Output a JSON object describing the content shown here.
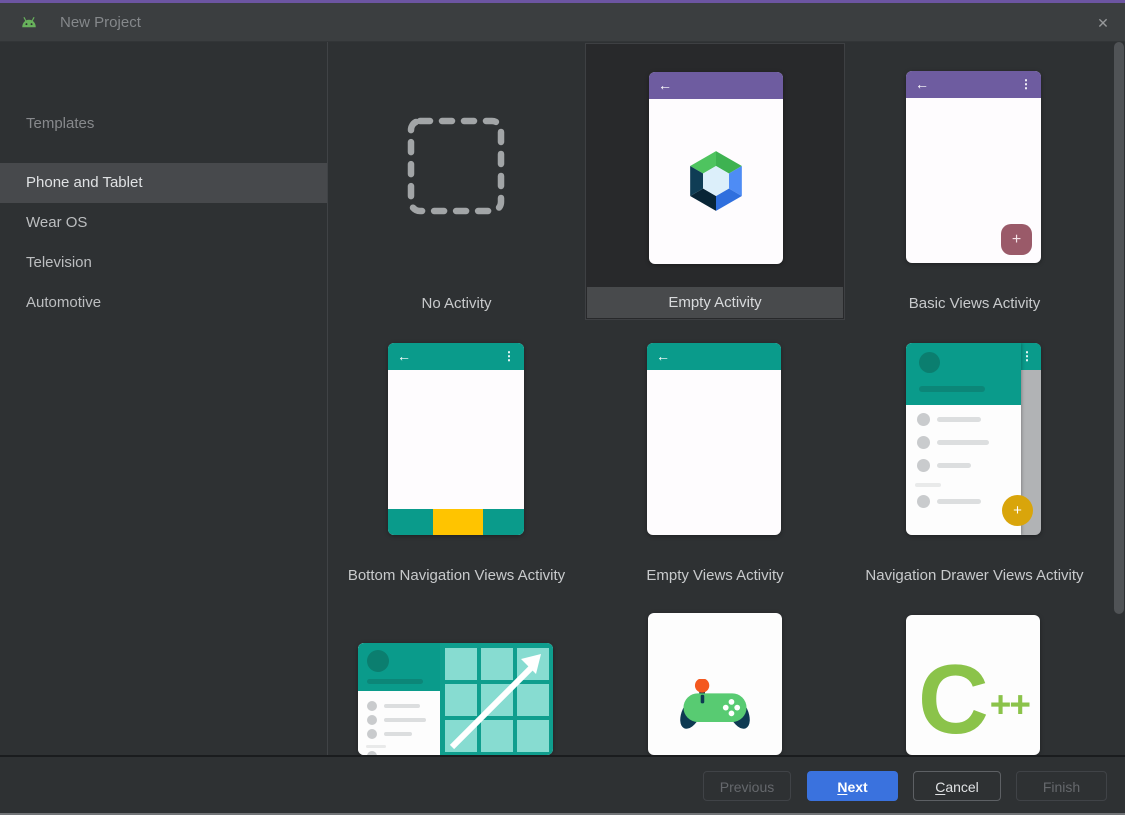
{
  "window": {
    "title": "New Project",
    "close_icon": "✕"
  },
  "sidebar": {
    "header": "Templates",
    "items": [
      {
        "label": "Phone and Tablet",
        "selected": true
      },
      {
        "label": "Wear OS",
        "selected": false
      },
      {
        "label": "Television",
        "selected": false
      },
      {
        "label": "Automotive",
        "selected": false
      }
    ]
  },
  "gallery": {
    "cards": [
      {
        "label": "No Activity",
        "selected": false
      },
      {
        "label": "Empty Activity",
        "selected": true
      },
      {
        "label": "Basic Views Activity",
        "selected": false
      },
      {
        "label": "Bottom Navigation Views Activity",
        "selected": false
      },
      {
        "label": "Empty Views Activity",
        "selected": false
      },
      {
        "label": "Navigation Drawer Views Activity",
        "selected": false
      }
    ]
  },
  "icons": {
    "back_arrow": "←",
    "kebab_menu": "⋮",
    "plus": "+",
    "cpp_c": "C",
    "cpp_plusplus": "++"
  },
  "footer": {
    "previous_label": "Previous",
    "next_mnemonic": "N",
    "next_rest": "ext",
    "cancel_mnemonic": "C",
    "cancel_rest": "ancel",
    "finish_label": "Finish"
  },
  "colors": {
    "accent_top": "#6C55A2",
    "next_button_blue": "#3A72DE",
    "template_purple": "#6E5CA0",
    "template_teal": "#0A9B8B",
    "bottom_nav_amber": "#FFC400",
    "fab_mauve": "#9A5A69",
    "fab_gold": "#D9A50B",
    "compose_green": "#45BD55",
    "compose_blue": "#4285F4",
    "compose_navy": "#0D3550",
    "cpp_green": "#8BC34A",
    "controller_green": "#58CB72",
    "controller_navy": "#0E3A52",
    "controller_orange": "#F4581F",
    "selected_row_bg": "#47494C"
  }
}
